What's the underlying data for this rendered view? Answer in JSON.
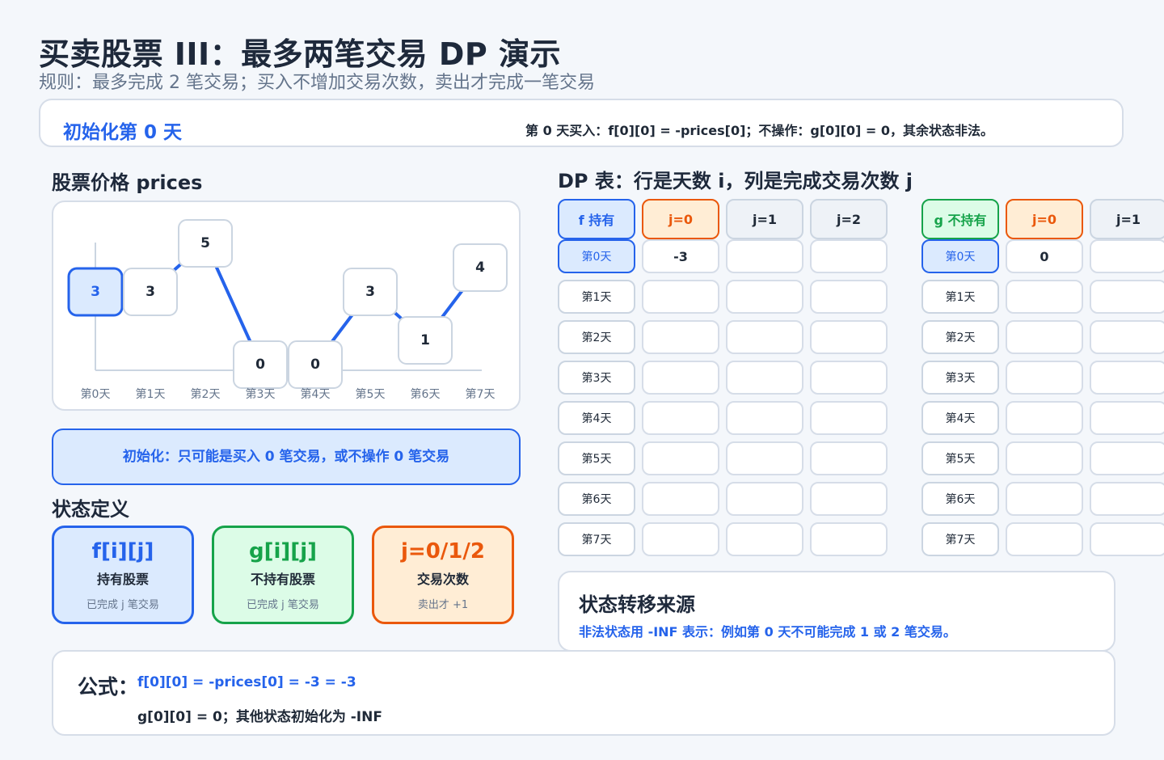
{
  "header": {
    "title": "买卖股票 III：最多两笔交易 DP 演示",
    "subtitle": "规则：最多完成 2 笔交易；买入不增加交易次数，卖出才完成一笔交易"
  },
  "step": {
    "name": "初始化第 0 天",
    "description": "第 0 天买入：f[0][0] = -prices[0]；不操作：g[0][0] = 0，其余状态非法。"
  },
  "prices_section": {
    "title": "股票价格 prices"
  },
  "chart_data": {
    "type": "line",
    "x": [
      "第0天",
      "第1天",
      "第2天",
      "第3天",
      "第4天",
      "第5天",
      "第6天",
      "第7天"
    ],
    "values": [
      3,
      3,
      5,
      0,
      0,
      3,
      1,
      4
    ],
    "active_index": 0,
    "ylim": [
      0,
      5
    ],
    "colors": {
      "line": "#2563eb",
      "active_fill": "#dbeafe",
      "active_border": "#2563eb"
    }
  },
  "info_box": {
    "text": "初始化：只可能是买入 0 笔交易，或不操作 0 笔交易"
  },
  "state_def": {
    "title": "状态定义",
    "cards": [
      {
        "symbol": "f[i][j]",
        "name": "持有股票",
        "note": "已完成 j 笔交易"
      },
      {
        "symbol": "g[i][j]",
        "name": "不持有股票",
        "note": "已完成 j 笔交易"
      },
      {
        "symbol": "j=0/1/2",
        "name": "交易次数",
        "note": "卖出才 +1"
      }
    ]
  },
  "dp_section": {
    "title": "DP 表：行是天数 i，列是完成交易次数 j"
  },
  "dp": {
    "f": {
      "header": [
        "f 持有",
        "j=0",
        "j=1",
        "j=2"
      ],
      "rows": [
        {
          "day": "第0天",
          "values": [
            "-3",
            "",
            ""
          ]
        },
        {
          "day": "第1天",
          "values": [
            "",
            "",
            ""
          ]
        },
        {
          "day": "第2天",
          "values": [
            "",
            "",
            ""
          ]
        },
        {
          "day": "第3天",
          "values": [
            "",
            "",
            ""
          ]
        },
        {
          "day": "第4天",
          "values": [
            "",
            "",
            ""
          ]
        },
        {
          "day": "第5天",
          "values": [
            "",
            "",
            ""
          ]
        },
        {
          "day": "第6天",
          "values": [
            "",
            "",
            ""
          ]
        },
        {
          "day": "第7天",
          "values": [
            "",
            "",
            ""
          ]
        }
      ]
    },
    "g": {
      "header": [
        "g 不持有",
        "j=0",
        "j=1"
      ],
      "rows": [
        {
          "day": "第0天",
          "values": [
            "0",
            ""
          ]
        },
        {
          "day": "第1天",
          "values": [
            "",
            ""
          ]
        },
        {
          "day": "第2天",
          "values": [
            "",
            ""
          ]
        },
        {
          "day": "第3天",
          "values": [
            "",
            ""
          ]
        },
        {
          "day": "第4天",
          "values": [
            "",
            ""
          ]
        },
        {
          "day": "第5天",
          "values": [
            "",
            ""
          ]
        },
        {
          "day": "第6天",
          "values": [
            "",
            ""
          ]
        },
        {
          "day": "第7天",
          "values": [
            "",
            ""
          ]
        }
      ]
    },
    "active_row": 0
  },
  "transition": {
    "title": "状态转移来源",
    "note": "非法状态用 -INF 表示：例如第 0 天不可能完成 1 或 2 笔交易。"
  },
  "formula": {
    "label": "公式：",
    "line1": "f[0][0] = -prices[0] = -3 = -3",
    "line2": "g[0][0] = 0；其他状态初始化为 -INF"
  }
}
